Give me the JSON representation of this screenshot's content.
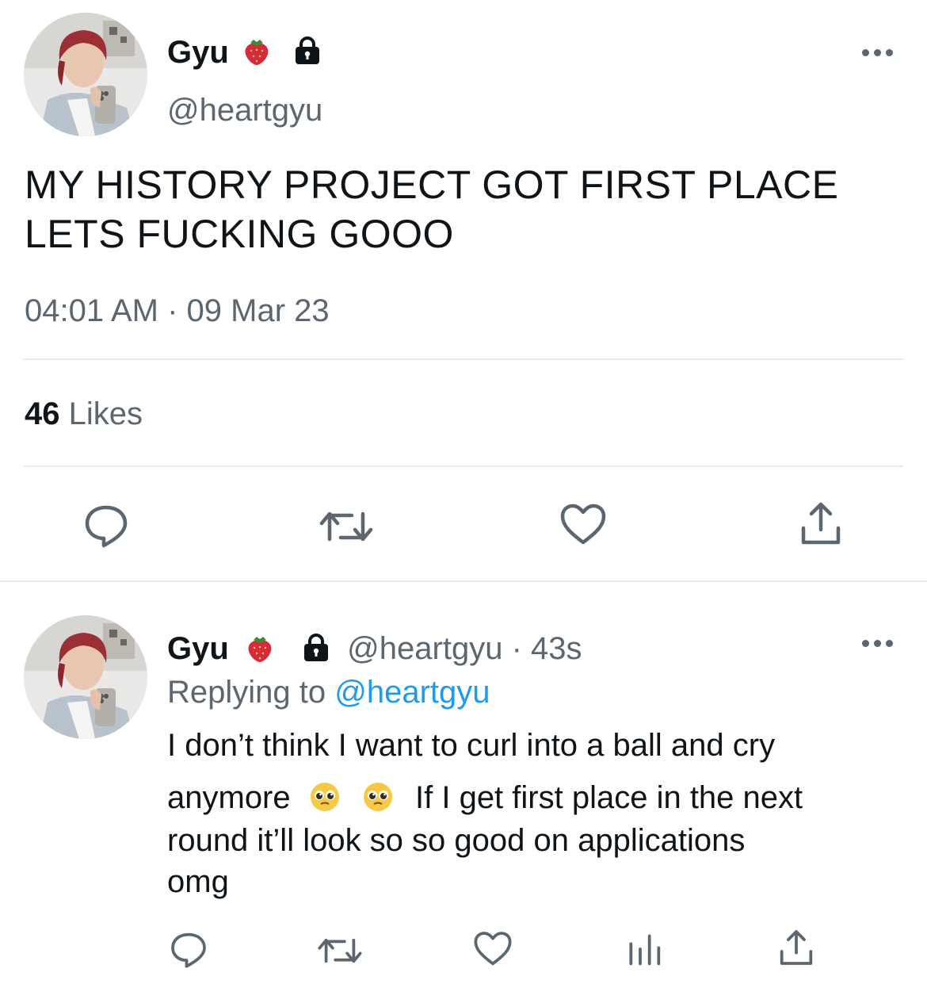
{
  "main_tweet": {
    "user": {
      "name": "Gyu",
      "handle": "@heartgyu",
      "name_emoji": "strawberry-icon",
      "badge_icon": "lock-icon"
    },
    "text_lines": [
      "MY HISTORY PROJECT GOT FIRST PLACE",
      "LETS FUCKING GOOO"
    ],
    "timestamp": "04:01 AM · 09 Mar 23",
    "likes_count": "46",
    "likes_label": "Likes",
    "actions": [
      "reply-icon",
      "retweet-icon",
      "like-icon",
      "share-icon"
    ]
  },
  "reply_tweet": {
    "user": {
      "name": "Gyu",
      "handle": "@heartgyu",
      "sep": "·",
      "time": "43s",
      "name_emoji": "strawberry-icon",
      "badge_icon": "lock-icon"
    },
    "replying_label": "Replying to",
    "replying_handle": "@heartgyu",
    "line1": "I don’t think I want to curl into a ball and cry",
    "line2_prefix": "anymore",
    "line2_suffix": "If I get first place in the next",
    "line2_emojis": [
      "pleading-face-icon",
      "pleading-face-icon"
    ],
    "line3": "round it’ll look so so good on applications",
    "line4": "omg",
    "actions": [
      "reply-icon",
      "retweet-icon",
      "like-icon",
      "analytics-icon",
      "share-icon"
    ]
  },
  "colors": {
    "text": "#0f1419",
    "secondary": "#5b6670",
    "link": "#1d9bf0",
    "divider": "#e6ecf0"
  }
}
